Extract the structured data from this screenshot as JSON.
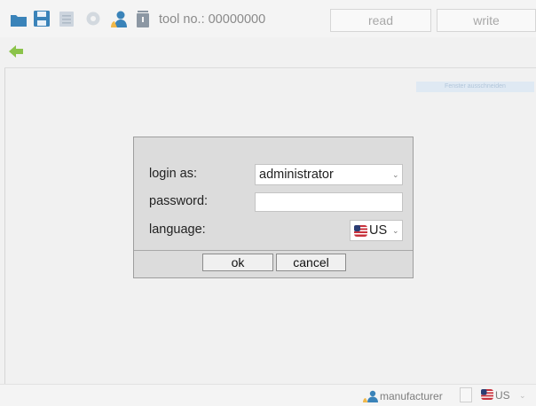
{
  "toolbar": {
    "icons": [
      {
        "name": "folder-open-icon",
        "color": "#3a83b9"
      },
      {
        "name": "save-icon",
        "color": "#3a83b9"
      },
      {
        "name": "print-icon",
        "color": "#bcc6d0"
      },
      {
        "name": "settings-gear-icon",
        "color": "#cfd5db"
      },
      {
        "name": "user-icon",
        "color": "#3a83b9"
      },
      {
        "name": "trash-icon",
        "color": "#8c97a3"
      }
    ],
    "tool_label": "tool no.: 00000000",
    "read_label": "read",
    "write_label": "write"
  },
  "nav": {
    "back_icon": "back-arrow-icon",
    "back_color": "#8bc34a"
  },
  "hint_text": "Fenster ausschneiden",
  "login_dialog": {
    "login_label": "login as:",
    "login_value": "administrator",
    "password_label": "password:",
    "password_value": "",
    "language_label": "language:",
    "language_value": "US",
    "ok_label": "ok",
    "cancel_label": "cancel"
  },
  "status": {
    "user_label": "manufacturer",
    "language_value": "US"
  },
  "colors": {
    "accent": "#3a83b9",
    "background": "#f1f1f1",
    "dialog_background": "#dcdcdc"
  }
}
